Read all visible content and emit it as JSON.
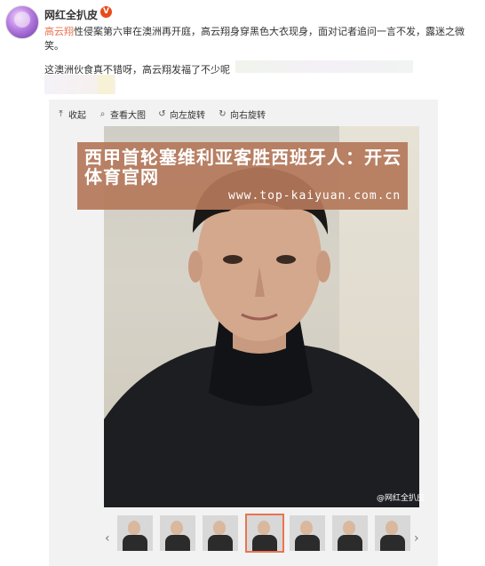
{
  "post": {
    "username": "网红全扒皮",
    "verified_badge": "V",
    "mention": "高云翔",
    "text_line1_rest": "性侵案第六审在澳洲再开庭，高云翔身穿黑色大衣现身，面对记者追问一言不发，露迷之微笑。",
    "text_line2": "这澳洲伙食真不错呀，高云翔发福了不少呢"
  },
  "toolbar": {
    "collapse": "收起",
    "view_large": "查看大图",
    "rotate_left": "向左旋转",
    "rotate_right": "向右旋转"
  },
  "watermark": {
    "title": "西甲首轮塞维利亚客胜西班牙人：开云体育官网",
    "url": "www.top-kaiyuan.com.cn"
  },
  "photo": {
    "credit": "@网红全扒皮"
  },
  "gallery": {
    "prev_icon": "chevron-left-icon",
    "next_icon": "chevron-right-icon",
    "selected_index": 3,
    "thumb_count": 7
  },
  "colors": {
    "mention": "#eb7350",
    "badge": "#e84b1a",
    "watermark_bg": "#b4785a"
  }
}
